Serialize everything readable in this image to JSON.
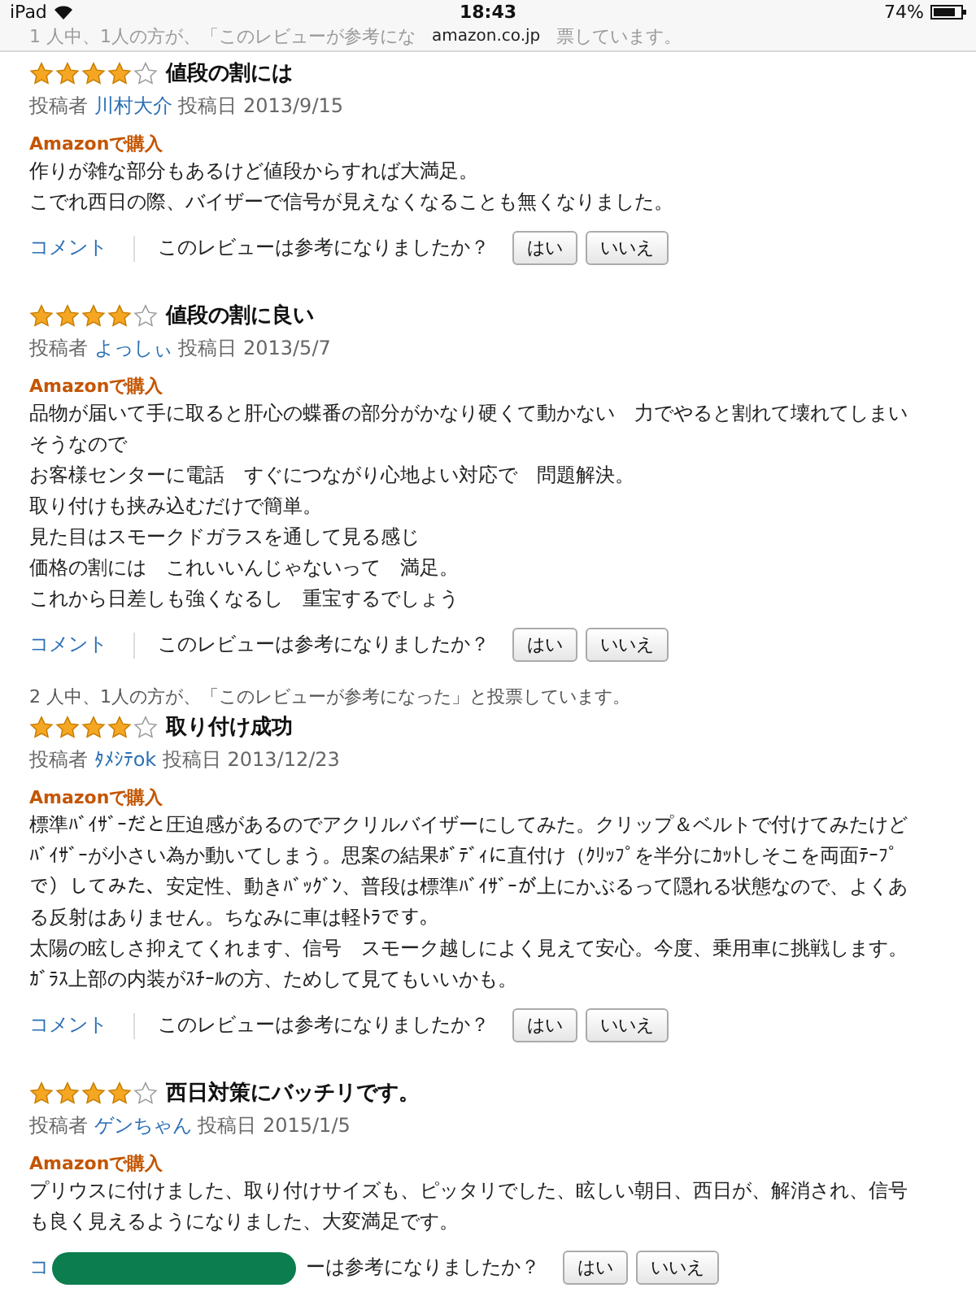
{
  "status_bar": {
    "device": "iPad",
    "time": "18:43",
    "battery": "74%"
  },
  "address_bar": {
    "url": "amazon.co.jp",
    "behind_text": [
      "1 人中、1人の方が、「このレビューが参考にな",
      "票しています。"
    ]
  },
  "reviews": [
    {
      "stars": 4,
      "title": "値段の割には",
      "author_label": "投稿者",
      "author": "川村大介",
      "date_label": "投稿日 2013/9/15",
      "badge": "Amazonで購入",
      "body": [
        "作りが雑な部分もあるけど値段からすれば大満足。",
        "こでれ西日の際、バイザーで信号が見えなくなることも無くなりました。"
      ],
      "comment": "コメント",
      "question": "このレビューは参考になりましたか？",
      "buttons": [
        "はい",
        "いいえ"
      ]
    },
    {
      "stars": 4,
      "title": "値段の割に良い",
      "author_label": "投稿者",
      "author": "よっしぃ",
      "date_label": "投稿日 2013/5/7",
      "badge": "Amazonで購入",
      "body": [
        "品物が届いて手に取ると肝心の蝶番の部分がかなり硬くて動かない　力でやると割れて壊れてしまいそうなので",
        "お客様センターに電話　すぐにつながり心地よい対応で　問題解決。",
        "取り付けも挟み込むだけで簡単。",
        "見た目はスモークドガラスを通して見る感じ",
        "価格の割には　これいいんじゃないって　満足。",
        "これから日差しも強くなるし　重宝するでしょう"
      ],
      "comment": "コメント",
      "question": "このレビューは参考になりましたか？",
      "buttons": [
        "はい",
        "いいえ"
      ]
    },
    {
      "helpful": "2 人中、1人の方が、「このレビューが参考になった」と投票しています。",
      "stars": 4,
      "title": "取り付け成功",
      "author_label": "投稿者",
      "author": "ﾀﾒｼﾃok",
      "date_label": "投稿日 2013/12/23",
      "badge": "Amazonで購入",
      "body": [
        "標準ﾊﾞｲｻﾞｰだと圧迫感があるのでアクリルバイザーにしてみた。クリップ＆ベルトで付けてみたけどﾊﾞｲｻﾞｰが小さい為か動いてしまう。思案の結果ﾎﾞﾃﾞｨに直付け（ｸﾘｯﾌﾟを半分にｶｯﾄしそこを両面ﾃｰﾌﾟで）してみた、安定性、動きﾊﾞｯｸﾞﾝ、普段は標準ﾊﾞｲｻﾞｰが上にかぶるって隠れる状態なので、よくある反射はありません。ちなみに車は軽ﾄﾗです。",
        "太陽の眩しさ抑えてくれます、信号　スモーク越しによく見えて安心。今度、乗用車に挑戦します。ｶﾞﾗｽ上部の内装がｽﾁｰﾙの方、ためして見てもいいかも。"
      ],
      "comment": "コメント",
      "question": "このレビューは参考になりましたか？",
      "buttons": [
        "はい",
        "いいえ"
      ]
    },
    {
      "stars": 4,
      "title": "西日対策にバッチリです。",
      "author_label": "投稿者",
      "author": "ゲンちゃん",
      "date_label": "投稿日 2015/1/5",
      "badge": "Amazonで購入",
      "body": [
        "プリウスに付けました、取り付けサイズも、ピッタリでした、眩しい朝日、西日が、解消され、信号も良く見えるようになりました、大変満足です。"
      ],
      "comment": "コ",
      "question": "ーは参考になりましたか？",
      "redacted": true,
      "buttons": [
        "はい",
        "いいえ"
      ]
    }
  ]
}
